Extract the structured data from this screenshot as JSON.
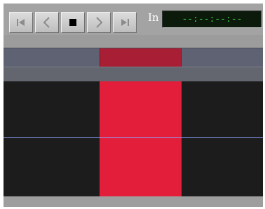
{
  "transport": {
    "buttons": [
      {
        "id": "skip-start",
        "icon": "skip-to-start-icon"
      },
      {
        "id": "step-back",
        "icon": "step-back-icon"
      },
      {
        "id": "stop",
        "icon": "stop-icon"
      },
      {
        "id": "step-forward",
        "icon": "step-forward-icon"
      },
      {
        "id": "skip-end",
        "icon": "skip-to-end-icon"
      }
    ],
    "in_label": "In",
    "timecode": "--:--:--:--"
  },
  "colors": {
    "selection": "#e31e3b",
    "selection_header": "#a81e34",
    "track_background": "#1c1c1c",
    "cursor_line": "#8fa0ff",
    "timecode_text": "#39c43e"
  }
}
